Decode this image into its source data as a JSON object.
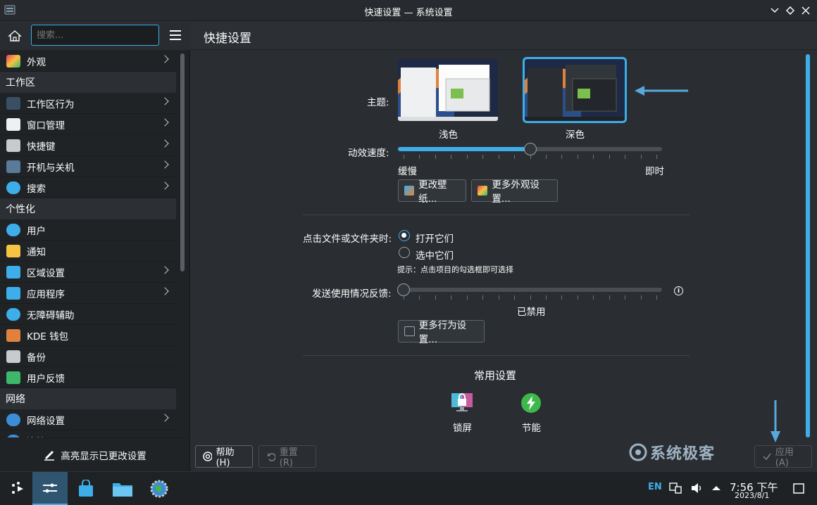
{
  "window": {
    "title": "快速设置 — 系统设置"
  },
  "sidebar": {
    "search_placeholder": "搜索...",
    "items": [
      {
        "type": "item",
        "label": "外观",
        "icon": "appearance-icon",
        "chevron": true
      },
      {
        "type": "cat",
        "label": "工作区"
      },
      {
        "type": "item",
        "label": "工作区行为",
        "icon": "workspace-behavior-icon",
        "chevron": true
      },
      {
        "type": "item",
        "label": "窗口管理",
        "icon": "window-management-icon",
        "chevron": true
      },
      {
        "type": "item",
        "label": "快捷键",
        "icon": "keyboard-icon",
        "chevron": true
      },
      {
        "type": "item",
        "label": "开机与关机",
        "icon": "startup-shutdown-icon",
        "chevron": true
      },
      {
        "type": "item",
        "label": "搜索",
        "icon": "search-icon",
        "chevron": true
      },
      {
        "type": "cat",
        "label": "个性化"
      },
      {
        "type": "item",
        "label": "用户",
        "icon": "users-icon",
        "chevron": false
      },
      {
        "type": "item",
        "label": "通知",
        "icon": "bell-icon",
        "chevron": false
      },
      {
        "type": "item",
        "label": "区域设置",
        "icon": "region-icon",
        "chevron": true
      },
      {
        "type": "item",
        "label": "应用程序",
        "icon": "applications-icon",
        "chevron": true
      },
      {
        "type": "item",
        "label": "无障碍辅助",
        "icon": "accessibility-icon",
        "chevron": false
      },
      {
        "type": "item",
        "label": "KDE 钱包",
        "icon": "wallet-icon",
        "chevron": false
      },
      {
        "type": "item",
        "label": "备份",
        "icon": "backup-icon",
        "chevron": false
      },
      {
        "type": "item",
        "label": "用户反馈",
        "icon": "feedback-icon",
        "chevron": false
      },
      {
        "type": "cat",
        "label": "网络"
      },
      {
        "type": "item",
        "label": "网络设置",
        "icon": "network-globe-icon",
        "chevron": true
      },
      {
        "type": "item",
        "label": "连接",
        "icon": "connections-icon",
        "chevron": false
      }
    ],
    "footer_label": "高亮显示已更改设置"
  },
  "main": {
    "title": "快捷设置",
    "theme_label": "主题:",
    "theme_light": "浅色",
    "theme_dark": "深色",
    "animation_label": "动效速度:",
    "animation_slow": "缓慢",
    "animation_instant": "即时",
    "animation_value": 0.5,
    "change_wallpaper": "更改壁纸...",
    "more_appearance": "更多外观设置...",
    "click_label": "点击文件或文件夹时:",
    "click_open": "打开它们",
    "click_select": "选中它们",
    "click_hint": "提示：点击项目的勾选框即可选择",
    "feedback_label": "发送使用情况反馈:",
    "feedback_value_text": "已禁用",
    "feedback_value": 0,
    "more_behavior": "更多行为设置...",
    "common_title": "常用设置",
    "lock_screen": "锁屏",
    "power_saving": "节能"
  },
  "footer": {
    "help": "帮助(H)",
    "reset": "重置(R)",
    "apply": "应用(A)",
    "watermark": "系统极客"
  },
  "taskbar": {
    "lang": "EN",
    "time": "7:56 下午",
    "date": "2023/8/1"
  },
  "colors": {
    "accent": "#3daee9",
    "bg": "#2a2e32",
    "sidebar": "#202326"
  }
}
